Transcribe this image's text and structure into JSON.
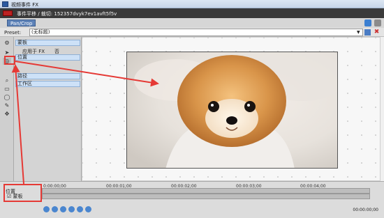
{
  "window": {
    "title": "视频事件 FX"
  },
  "header": {
    "event_label": "事件平移 / 裁切: 152357dvyk7ev1avft5f5v",
    "tab_label": "Pan/Crop"
  },
  "preset": {
    "label": "Preset:",
    "value": "(无标题)"
  },
  "toolbar": {
    "tools": [
      {
        "name": "gear-icon"
      },
      {
        "name": "cursor-icon"
      },
      {
        "name": "sync-icon"
      },
      {
        "name": "zoom-icon"
      },
      {
        "name": "rectangle-icon"
      },
      {
        "name": "ellipse-icon"
      },
      {
        "name": "pen-icon"
      },
      {
        "name": "move-icon"
      }
    ]
  },
  "properties": {
    "mask": "蒙板",
    "apply_fx_label": "应用于 FX",
    "apply_fx_value": "否",
    "position": "位置",
    "path": "路径",
    "workspace": "工作区"
  },
  "timeline": {
    "times": [
      "0:00:00;00",
      "00:00:01;00",
      "00:00:02;00",
      "00:00:03;00",
      "00:00:04;00"
    ],
    "track_position": "位置",
    "track_mask": "蒙板",
    "end_time": "00:00:00;00"
  }
}
